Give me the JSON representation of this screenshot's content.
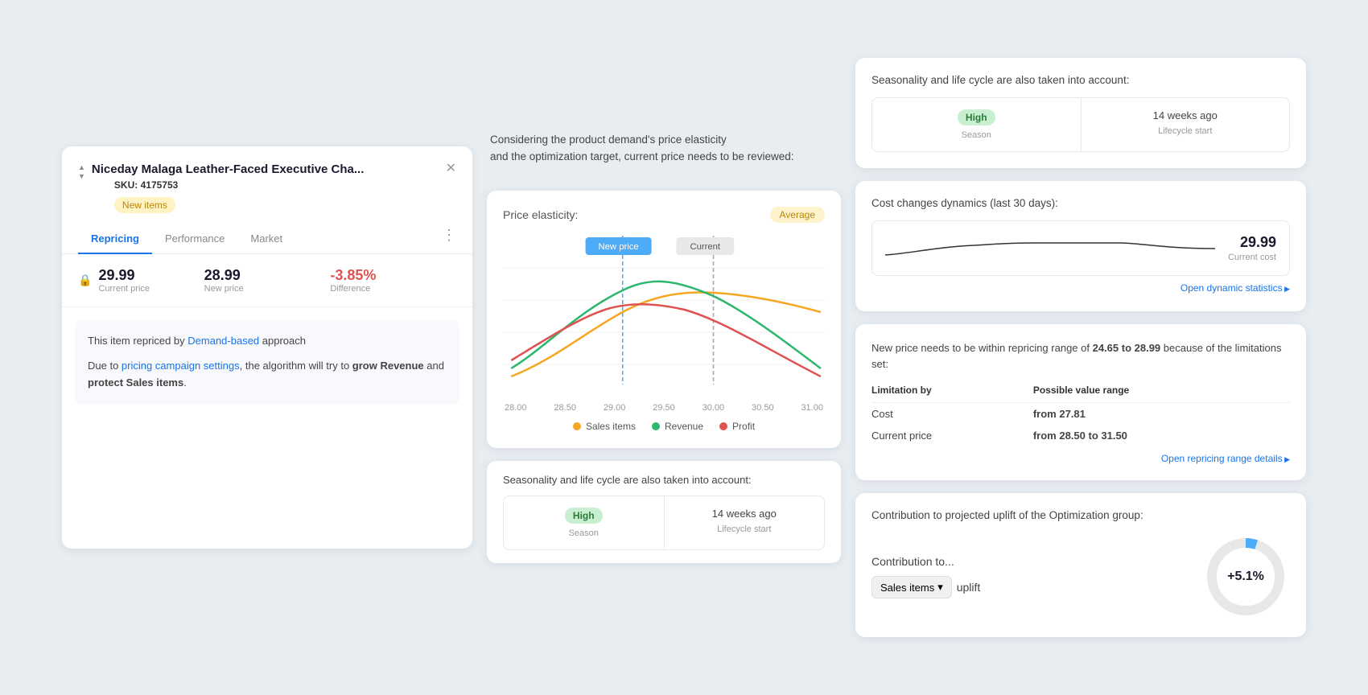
{
  "left": {
    "product_name": "Niceday Malaga Leather-Faced Executive Cha...",
    "sku_label": "SKU:",
    "sku_value": "4175753",
    "badge": "New items",
    "tabs": [
      "Repricing",
      "Performance",
      "Market"
    ],
    "current_price_val": "29.99",
    "current_price_label": "Current price",
    "new_price_val": "28.99",
    "new_price_label": "New price",
    "difference_val": "-3.85%",
    "difference_label": "Difference",
    "desc_line1_pre": "This item repriced by ",
    "desc_link1": "Demand-based",
    "desc_line1_post": " approach",
    "desc_line2_pre": "Due to ",
    "desc_link2": "pricing campaign settings",
    "desc_line2_mid": ", the algorithm will try to ",
    "desc_bold1": "grow Revenue",
    "desc_line2_and": " and ",
    "desc_bold2": "protect Sales items",
    "desc_line2_end": "."
  },
  "mid": {
    "intro": "Considering the product demand's price elasticity\nand the optimization target, current price needs to be reviewed:",
    "chart_title": "Price elasticity:",
    "chart_badge": "Average",
    "new_price_label": "New price",
    "current_label": "Current",
    "x_axis": [
      "28.00",
      "28.50",
      "29.00",
      "29.50",
      "30.00",
      "30.50",
      "31.00"
    ],
    "legend": [
      {
        "label": "Sales items",
        "color": "#f5a623"
      },
      {
        "label": "Revenue",
        "color": "#2db66e"
      },
      {
        "label": "Profit",
        "color": "#e05252"
      }
    ],
    "season_title": "Seasonality and life cycle are also taken into account:",
    "season_val": "High",
    "season_label": "Season",
    "lifecycle_val": "14 weeks ago",
    "lifecycle_label": "Lifecycle start"
  },
  "right": {
    "season_title": "Seasonality and life cycle are also taken into account:",
    "season_val": "High",
    "season_label": "Season",
    "lifecycle_val": "14 weeks ago",
    "lifecycle_label": "Lifecycle start",
    "cost_title": "Cost changes dynamics (last 30 days):",
    "cost_val": "29.99",
    "cost_label": "Current cost",
    "open_dynamic": "Open dynamic statistics",
    "range_pre": "New price needs to be within repricing range of ",
    "range_bold": "24.65 to 28.99",
    "range_post": " because of the limitations set:",
    "limit_col1": "Limitation by",
    "limit_col2": "Possible value range",
    "limit_rows": [
      {
        "by": "Cost",
        "range": "from 27.81"
      },
      {
        "by": "Current price",
        "range": "from 28.50 to 31.50"
      }
    ],
    "open_repricing": "Open repricing range details",
    "uplift_title": "Contribution to projected uplift of the Optimization group:",
    "contribution_label": "Contribution to...",
    "select_label": "Sales items",
    "uplift_word": "uplift",
    "uplift_pct": "+5.1%",
    "donut_filled": 5.1,
    "donut_total": 100
  }
}
